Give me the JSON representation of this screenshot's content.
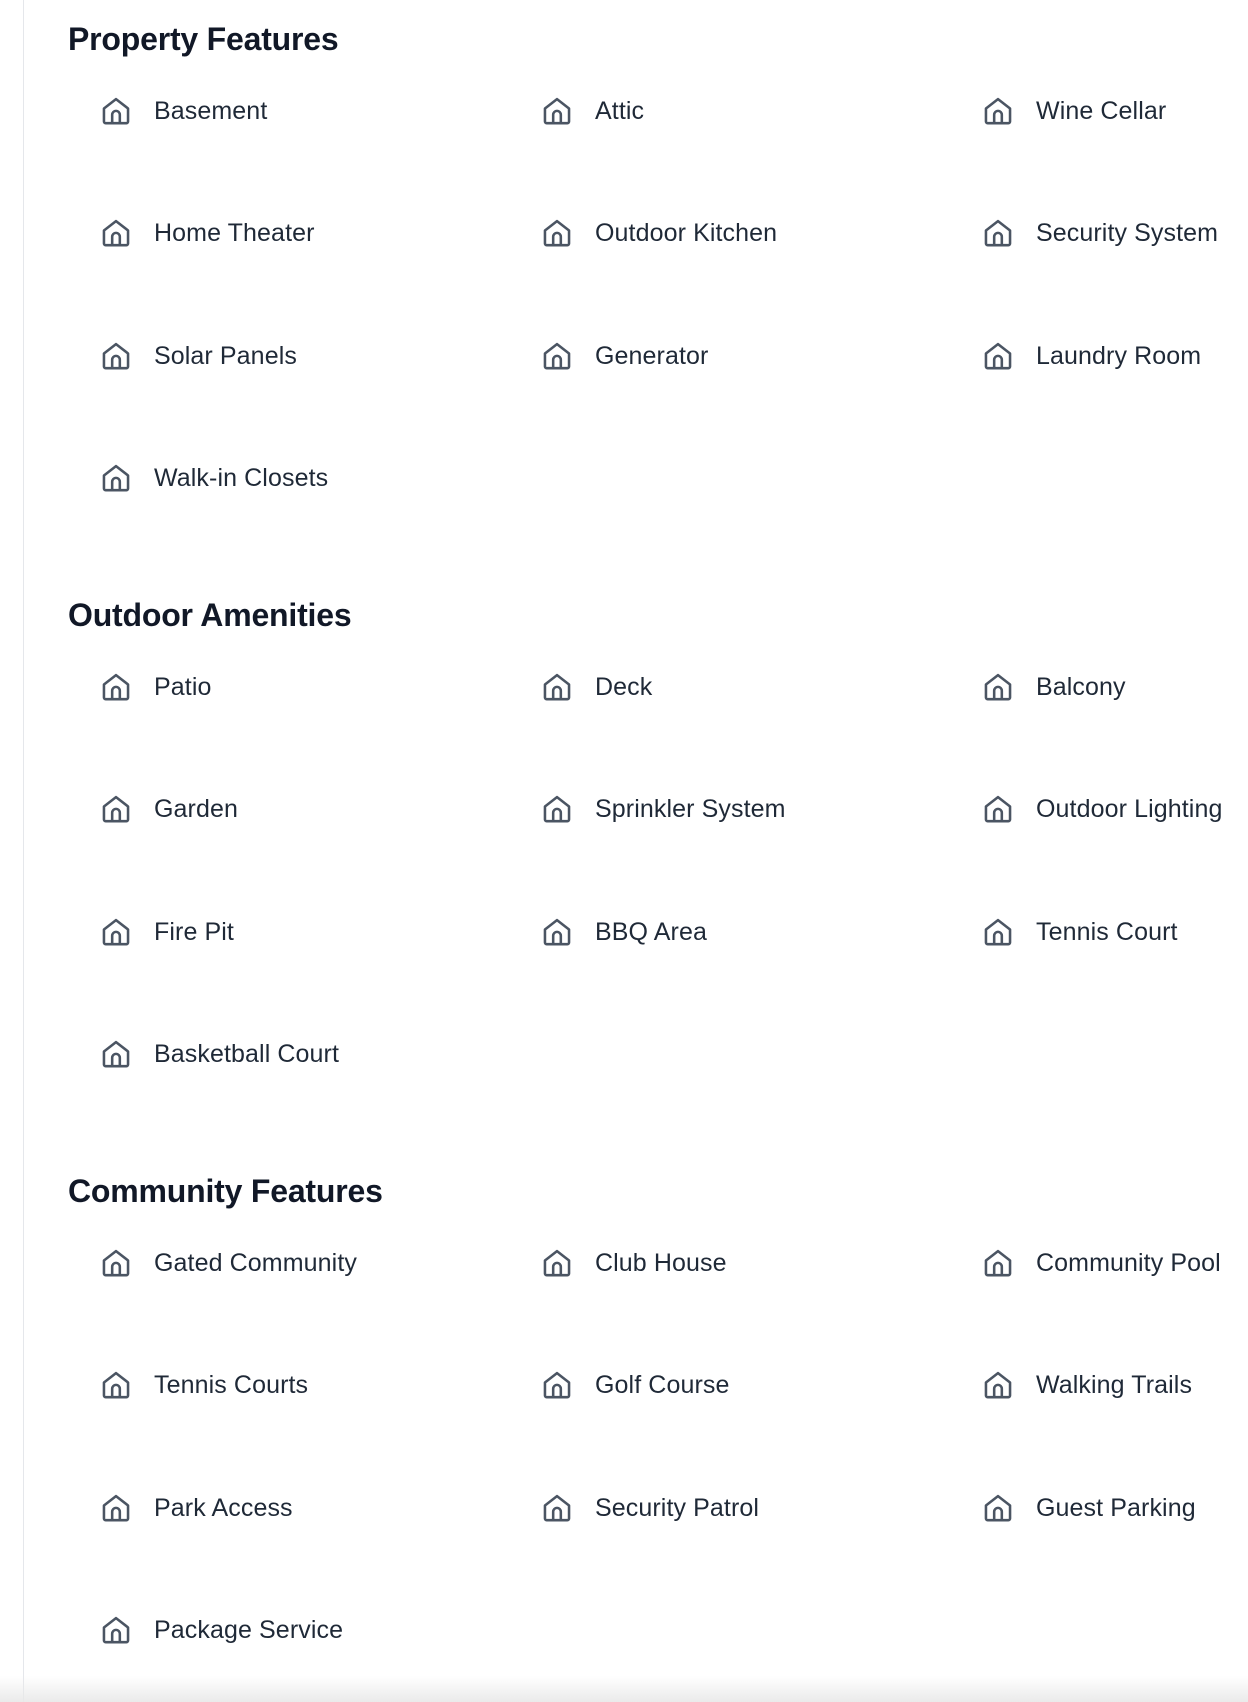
{
  "sections": [
    {
      "title": "Property Features",
      "items": [
        {
          "label": "Basement",
          "icon": "home-icon"
        },
        {
          "label": "Attic",
          "icon": "home-icon"
        },
        {
          "label": "Wine Cellar",
          "icon": "home-icon"
        },
        {
          "label": "Home Theater",
          "icon": "home-icon"
        },
        {
          "label": "Outdoor Kitchen",
          "icon": "home-icon"
        },
        {
          "label": "Security System",
          "icon": "home-icon"
        },
        {
          "label": "Solar Panels",
          "icon": "home-icon"
        },
        {
          "label": "Generator",
          "icon": "home-icon"
        },
        {
          "label": "Laundry Room",
          "icon": "home-icon"
        },
        {
          "label": "Walk-in Closets",
          "icon": "home-icon"
        }
      ]
    },
    {
      "title": "Outdoor Amenities",
      "items": [
        {
          "label": "Patio",
          "icon": "home-icon"
        },
        {
          "label": "Deck",
          "icon": "home-icon"
        },
        {
          "label": "Balcony",
          "icon": "home-icon"
        },
        {
          "label": "Garden",
          "icon": "home-icon"
        },
        {
          "label": "Sprinkler System",
          "icon": "home-icon"
        },
        {
          "label": "Outdoor Lighting",
          "icon": "home-icon"
        },
        {
          "label": "Fire Pit",
          "icon": "home-icon"
        },
        {
          "label": "BBQ Area",
          "icon": "home-icon"
        },
        {
          "label": "Tennis Court",
          "icon": "home-icon"
        },
        {
          "label": "Basketball Court",
          "icon": "home-icon"
        }
      ]
    },
    {
      "title": "Community Features",
      "items": [
        {
          "label": "Gated Community",
          "icon": "home-icon"
        },
        {
          "label": "Club House",
          "icon": "home-icon"
        },
        {
          "label": "Community Pool",
          "icon": "home-icon"
        },
        {
          "label": "Tennis Courts",
          "icon": "home-icon"
        },
        {
          "label": "Golf Course",
          "icon": "home-icon"
        },
        {
          "label": "Walking Trails",
          "icon": "home-icon"
        },
        {
          "label": "Park Access",
          "icon": "home-icon"
        },
        {
          "label": "Security Patrol",
          "icon": "home-icon"
        },
        {
          "label": "Guest Parking",
          "icon": "home-icon"
        },
        {
          "label": "Package Service",
          "icon": "home-icon"
        }
      ]
    }
  ],
  "colors": {
    "heading": "#111827",
    "label": "#1f2937",
    "icon": "#4b5563",
    "divider": "#e5e7eb"
  }
}
